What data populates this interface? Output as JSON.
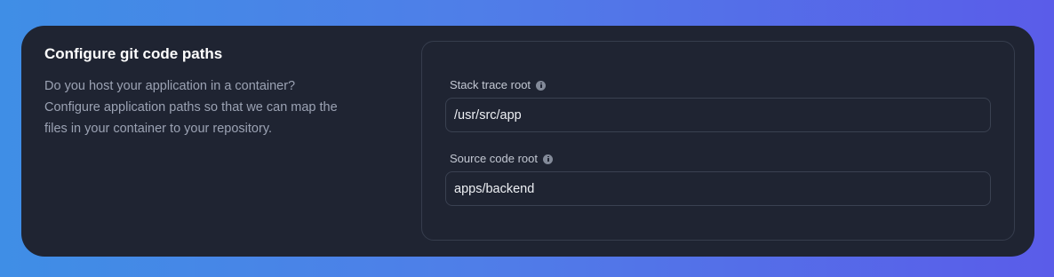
{
  "section": {
    "title": "Configure git code paths",
    "description": "Do you host your application in a container? Configure application paths so that we can map the files in your container to your repository."
  },
  "fields": {
    "stack_trace_root": {
      "label": "Stack trace root",
      "value": "/usr/src/app",
      "info_icon": "info-icon"
    },
    "source_code_root": {
      "label": "Source code root",
      "value": "apps/backend",
      "info_icon": "info-icon"
    }
  },
  "colors": {
    "background_gradient_start": "#3f8ee6",
    "background_gradient_end": "#5a5ce9",
    "card_background": "#1f2432",
    "panel_border": "#363d4d",
    "title_text": "#ffffff",
    "description_text": "#9ba2b3"
  }
}
